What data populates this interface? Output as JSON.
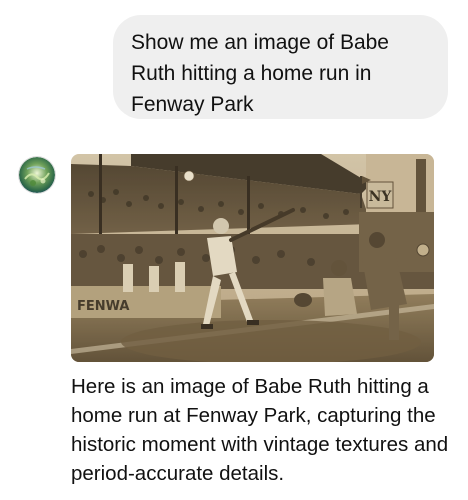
{
  "conversation": {
    "user_message": "Show me an image of Babe Ruth hitting a home run in Fenway Park",
    "assistant_message": "Here is an image of Babe Ruth hitting a home run at Fenway Park, capturing the historic moment with vintage textures and period-accurate details.",
    "image": {
      "sign_text": "FENWA",
      "logo_text": "NY",
      "tint": "#a8926c"
    }
  }
}
